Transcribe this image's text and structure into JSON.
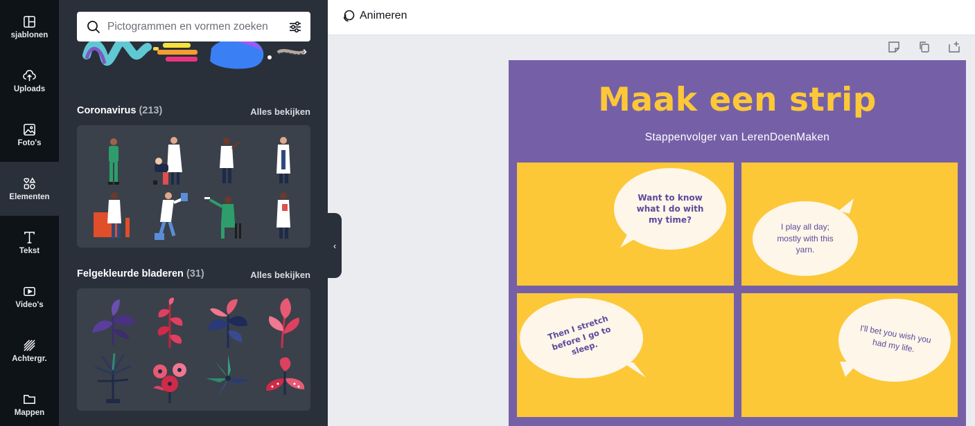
{
  "sidebar": {
    "items": [
      {
        "label": "sjablonen",
        "icon": "template-icon"
      },
      {
        "label": "Uploads",
        "icon": "upload-cloud-icon"
      },
      {
        "label": "Foto's",
        "icon": "photo-icon"
      },
      {
        "label": "Elementen",
        "icon": "shapes-icon"
      },
      {
        "label": "Tekst",
        "icon": "text-icon"
      },
      {
        "label": "Video's",
        "icon": "video-icon"
      },
      {
        "label": "Achtergr.",
        "icon": "background-icon"
      },
      {
        "label": "Mappen",
        "icon": "folder-icon"
      }
    ],
    "active_index": 3
  },
  "panel": {
    "search_placeholder": "Pictogrammen en vormen zoeken",
    "sections": [
      {
        "title": "Coronavirus",
        "count": "(213)",
        "see_all": "Alles bekijken"
      },
      {
        "title": "Felgekleurde bladeren",
        "count": "(31)",
        "see_all": "Alles bekijken"
      }
    ]
  },
  "toolbar": {
    "animate_label": "Animeren",
    "icons": [
      "note-icon",
      "duplicate-icon",
      "add-page-icon"
    ]
  },
  "design": {
    "title": "Maak een strip",
    "subtitle": "Stappenvolger van LerenDoenMaken",
    "bubbles": [
      "Want to know what I do with my time?",
      "I play all day; mostly with this yarn.",
      "Then I stretch before I go to sleep.",
      "I'll bet you wish you had my life."
    ]
  },
  "colors": {
    "accent_purple": "#7560a8",
    "accent_yellow": "#fcc838",
    "panel_bg": "#293039",
    "nav_bg": "#0e1318"
  }
}
